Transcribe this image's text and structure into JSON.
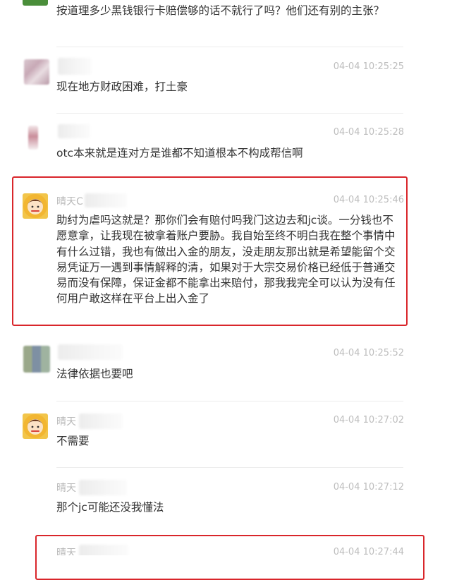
{
  "messages": [
    {
      "id": "m0",
      "time": "",
      "name": "",
      "text": "按道理多少黑钱银行卡赔偿够的话不就行了吗？他们还有别的主张？",
      "avatar_icon": "green-avatar-icon"
    },
    {
      "id": "m1",
      "time": "04-04 10:25:25",
      "name": "",
      "text": "现在地方财政困难，打土豪",
      "avatar_icon": "blurred-avatar-icon"
    },
    {
      "id": "m2",
      "time": "04-04 10:25:28",
      "name": "",
      "text": "otc本来就是连对方是谁都不知道根本不构成帮信啊",
      "avatar_icon": "blurred-avatar-icon"
    },
    {
      "id": "m3",
      "time": "04-04 10:25:46",
      "name": "晴天C",
      "text": "助纣为虐吗这就是？那你们会有赔付吗我门这边去和jc谈。一分钱也不愿意拿，让我现在被拿着账户要胁。我自始至终不明白我在整个事情中有什么过错，我也有做出入金的朋友，没走朋友那出就是希望能留个交易凭证万一遇到事情解释的清，如果对于大宗交易价格已经低于普通交易而没有保障，保证金都不能拿出来赔付，那我我完全可以认为没有任何用户敢这样在平台上出入金了",
      "avatar_icon": "cartoon-avatar-icon"
    },
    {
      "id": "m4",
      "time": "04-04 10:25:52",
      "name": "",
      "text": "法律依据也要吧",
      "avatar_icon": "blurred-avatar-icon"
    },
    {
      "id": "m5",
      "time": "04-04 10:27:02",
      "name": "晴天",
      "text": "不需要",
      "avatar_icon": "cartoon-avatar-icon"
    },
    {
      "id": "m6",
      "time": "04-04 10:27:12",
      "name": "晴天",
      "text": "那个jc可能还没我懂法",
      "avatar_icon": ""
    },
    {
      "id": "m7",
      "time": "04-04 10:27:44",
      "name": "晴天",
      "text": "",
      "avatar_icon": ""
    }
  ],
  "colors": {
    "highlight_border": "#d9262b",
    "timestamp": "#bdbdbd",
    "body_text": "#333333"
  }
}
